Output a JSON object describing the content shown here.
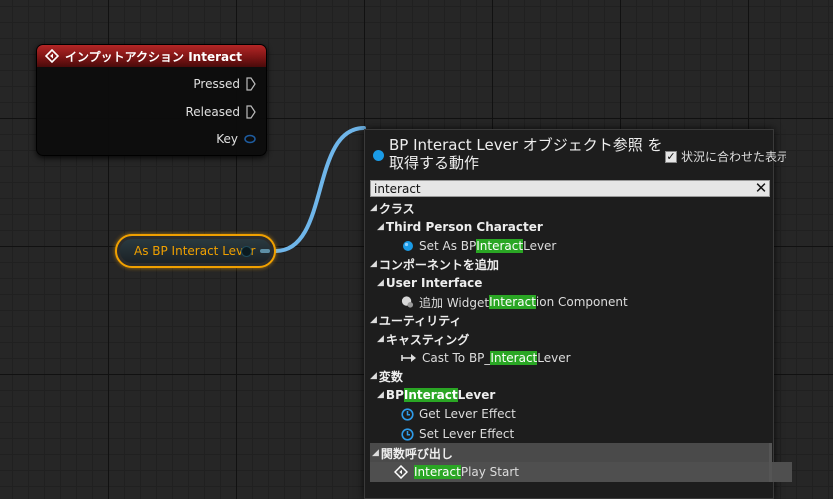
{
  "input_node": {
    "title": "インプットアクション Interact",
    "pins": [
      "Pressed",
      "Released",
      "Key"
    ]
  },
  "var_node": {
    "label": "As BP Interact Lever"
  },
  "menu": {
    "title": "BP Interact Lever オブジェクト参照 を取得する動作",
    "context_label": "状況に合わせた表示",
    "context_checked": "✓",
    "search_value": "interact",
    "clear_glyph": "✕",
    "categories": {
      "class": "クラス",
      "third_person": "Third Person Character",
      "add_component": "コンポーネントを追加",
      "user_interface": "User Interface",
      "utility": "ユーティリティ",
      "casting": "キャスティング",
      "variables": "変数",
      "bp_interact_pre": "BP ",
      "bp_interact_hl": "Interact",
      "bp_interact_post": " Lever",
      "function_call": "関数呼び出し"
    },
    "items": {
      "set_pre": "Set As BP ",
      "set_hl": "Interact",
      "set_post": " Lever",
      "add_pre": "追加 Widget ",
      "add_hl": "Interact",
      "add_post": "ion Component",
      "cast_pre": "Cast To BP_",
      "cast_hl": "Interact",
      "cast_post": "Lever",
      "get_effect": "Get Lever Effect",
      "set_effect": "Set Lever Effect",
      "play_hl": "Interact",
      "play_post": " Play Start"
    }
  },
  "colors": {
    "header_red": "#7e1515",
    "var_border": "#f0a000",
    "wire": "#6fb6ea",
    "highlight": "#2aa624",
    "object_blue": "#1a9be6"
  }
}
